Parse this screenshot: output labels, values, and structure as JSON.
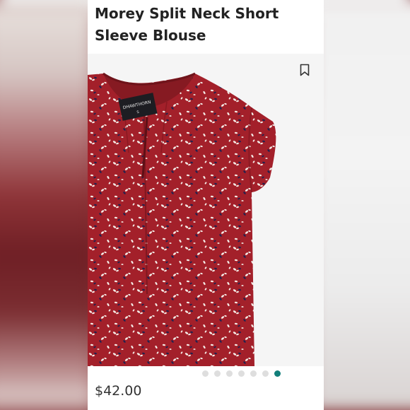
{
  "product": {
    "title": "Morey Split Neck Short Sleeve Blouse",
    "price": "$42.00",
    "brand_tag": "DHAWTHORN",
    "size_tag": "S"
  },
  "carousel": {
    "count": 7,
    "active_index": 6
  },
  "colors": {
    "fabric": "#a3202a",
    "accent": "#127f7a",
    "print_light": "#f3e9e4",
    "print_dark": "#23224e"
  },
  "icons": {
    "bookmark": "bookmark-icon"
  }
}
